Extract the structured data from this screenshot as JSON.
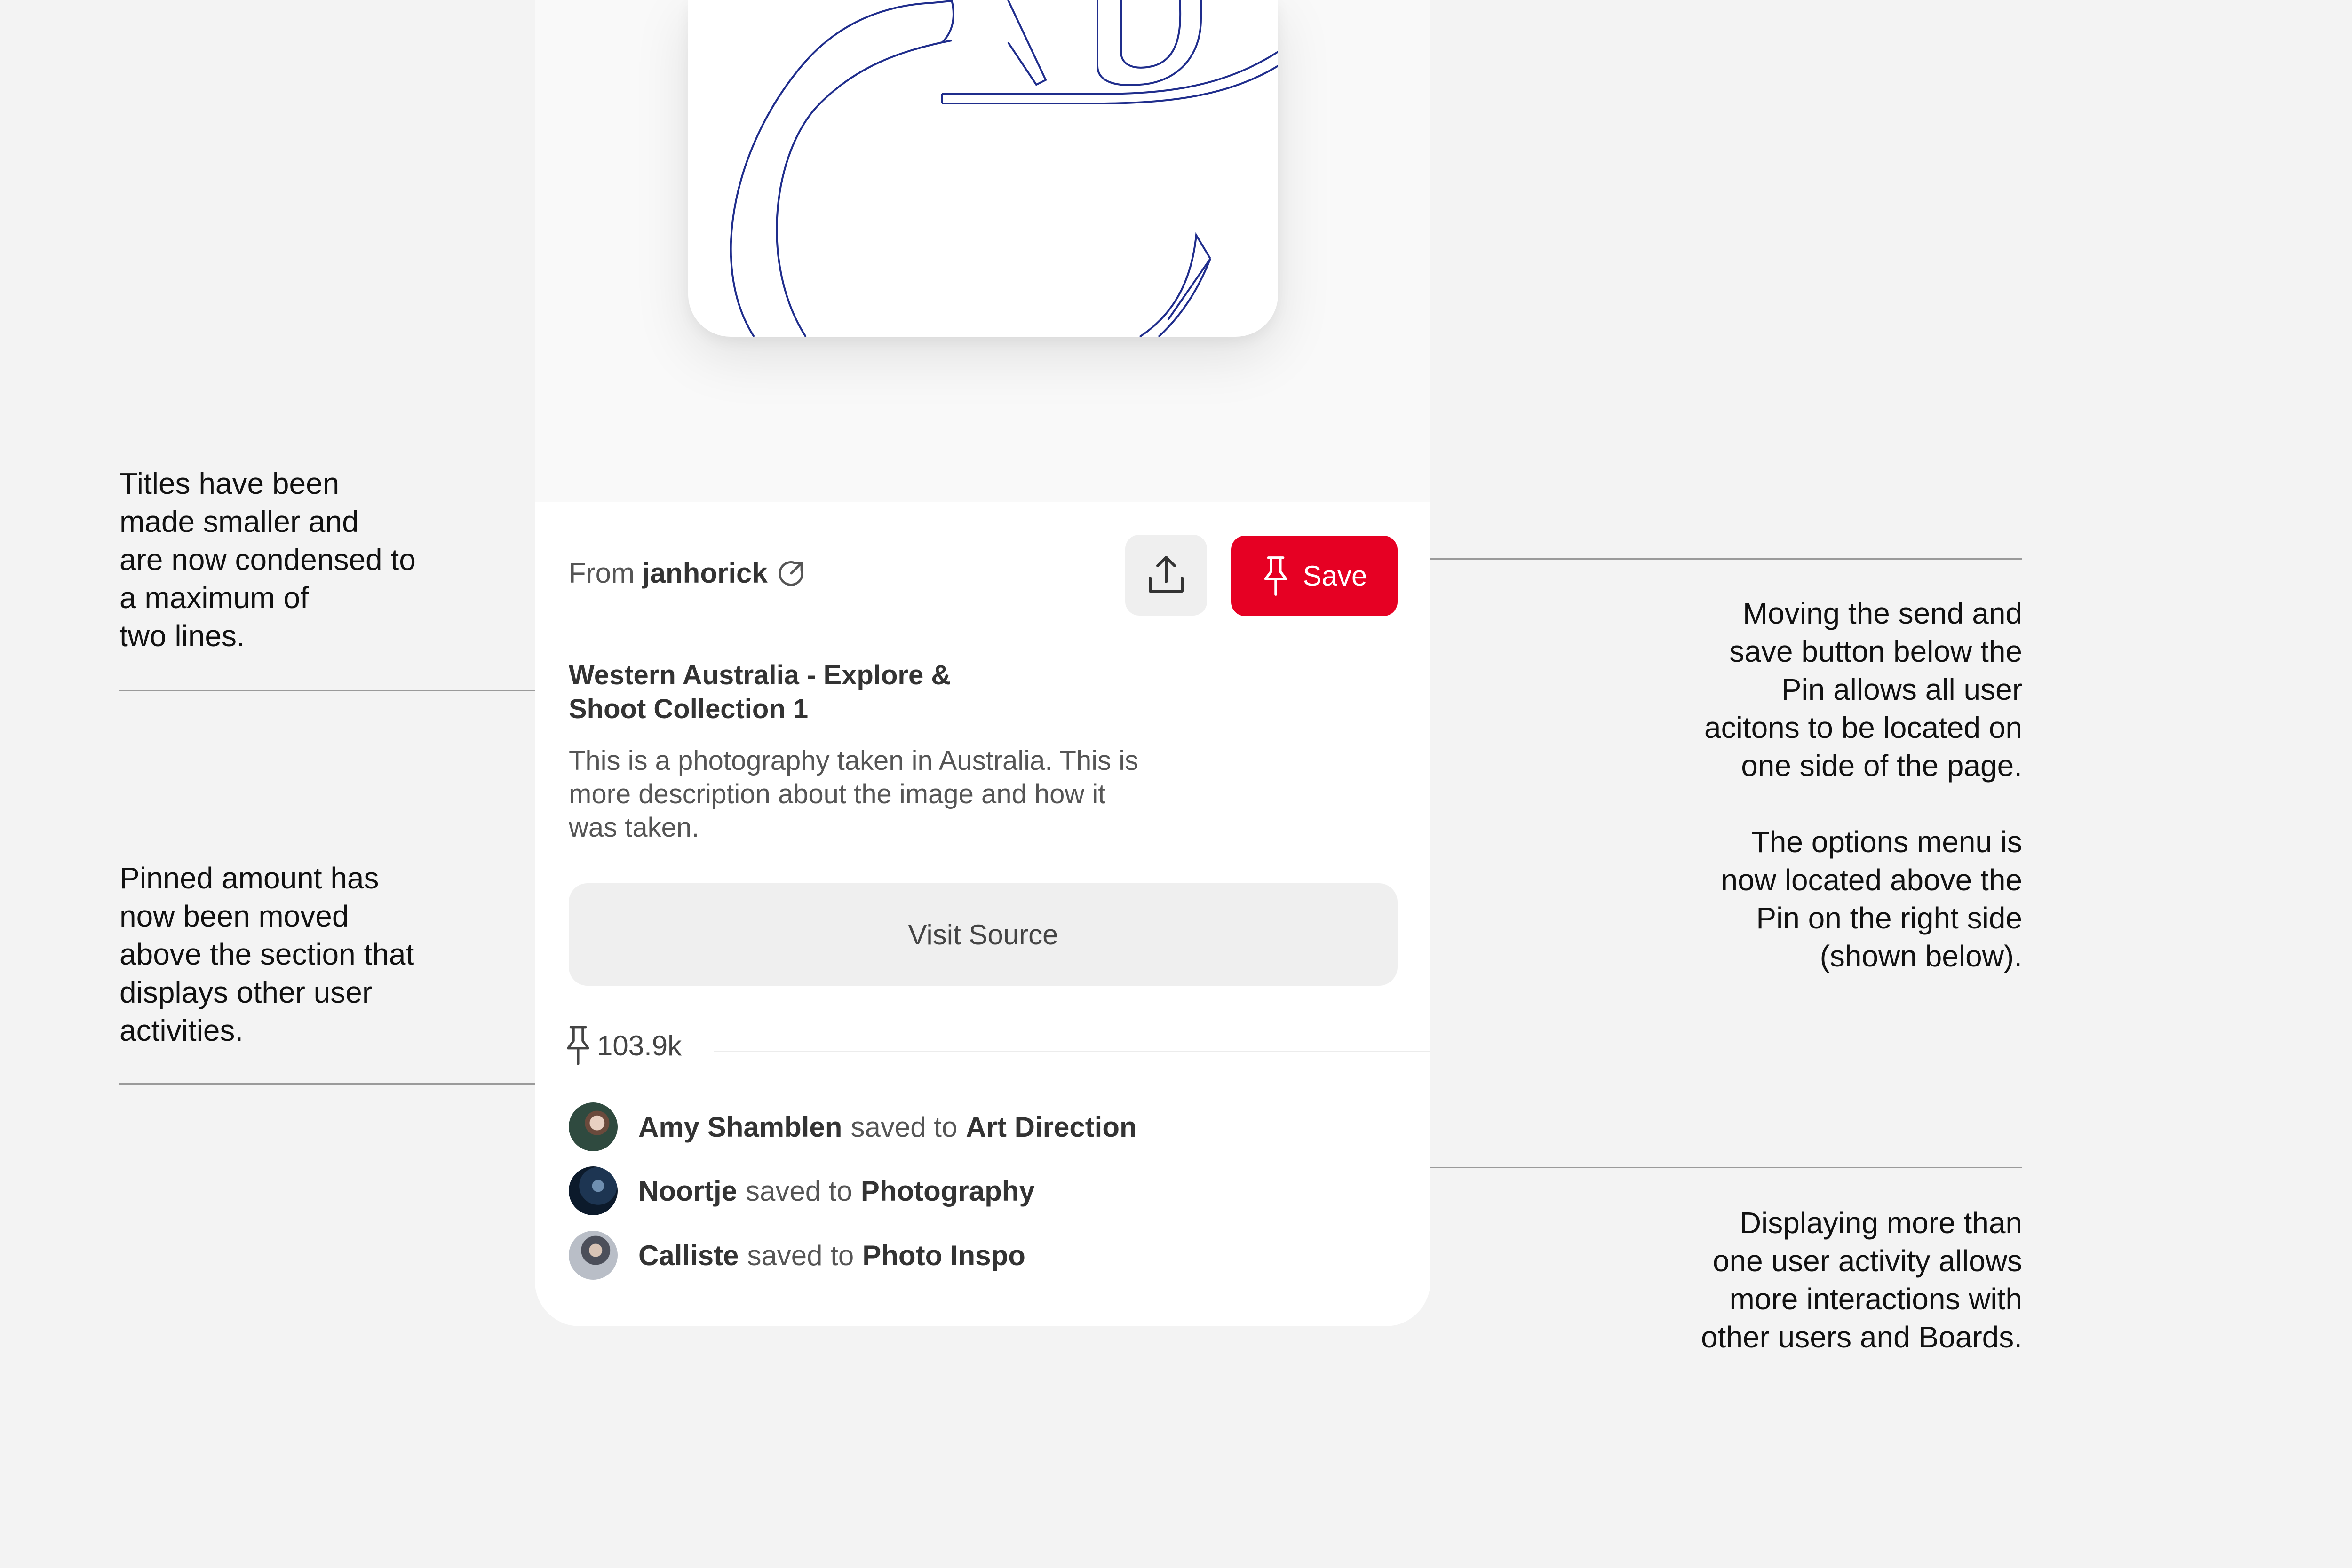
{
  "notes": {
    "titles": [
      "Titles have been",
      "made smaller and",
      "are now condensed to",
      "a maximum of",
      "two lines."
    ],
    "pinned": [
      "Pinned amount has",
      "now been moved",
      "above the section that",
      "displays other user",
      "activities."
    ],
    "moving": [
      "Moving the send and",
      "save button below the",
      "Pin allows all user",
      "acitons to be located on",
      "one side of the page."
    ],
    "options": [
      "The options menu is",
      "now located above the",
      "Pin on the right side",
      "(shown below)."
    ],
    "displaying": [
      "Displaying more than",
      "one user activity allows",
      "more interactions with",
      "other users and Boards."
    ]
  },
  "pin": {
    "from_prefix": "From",
    "from_user": "janhorick",
    "save_label": "Save",
    "title_lines": [
      "Western Australia - Explore &",
      "Shoot Collection 1"
    ],
    "description_lines": [
      "This is a photography taken in Australia. This is",
      "more description about the image and how it",
      "was taken."
    ],
    "visit_label": "Visit Source",
    "pin_count": "103.9k"
  },
  "activities": [
    {
      "user": "Amy Shamblen",
      "action": "saved to",
      "board": "Art Direction"
    },
    {
      "user": "Noortje",
      "action": "saved to",
      "board": "Photography"
    },
    {
      "user": "Calliste",
      "action": "saved to",
      "board": "Photo Inspo"
    }
  ],
  "colors": {
    "save": "#e60023",
    "line_art": "#1f2d8c",
    "background": "#f3f3f3"
  },
  "icons": {
    "share": "share-icon",
    "pin": "pushpin-icon",
    "external": "external-link-icon"
  }
}
